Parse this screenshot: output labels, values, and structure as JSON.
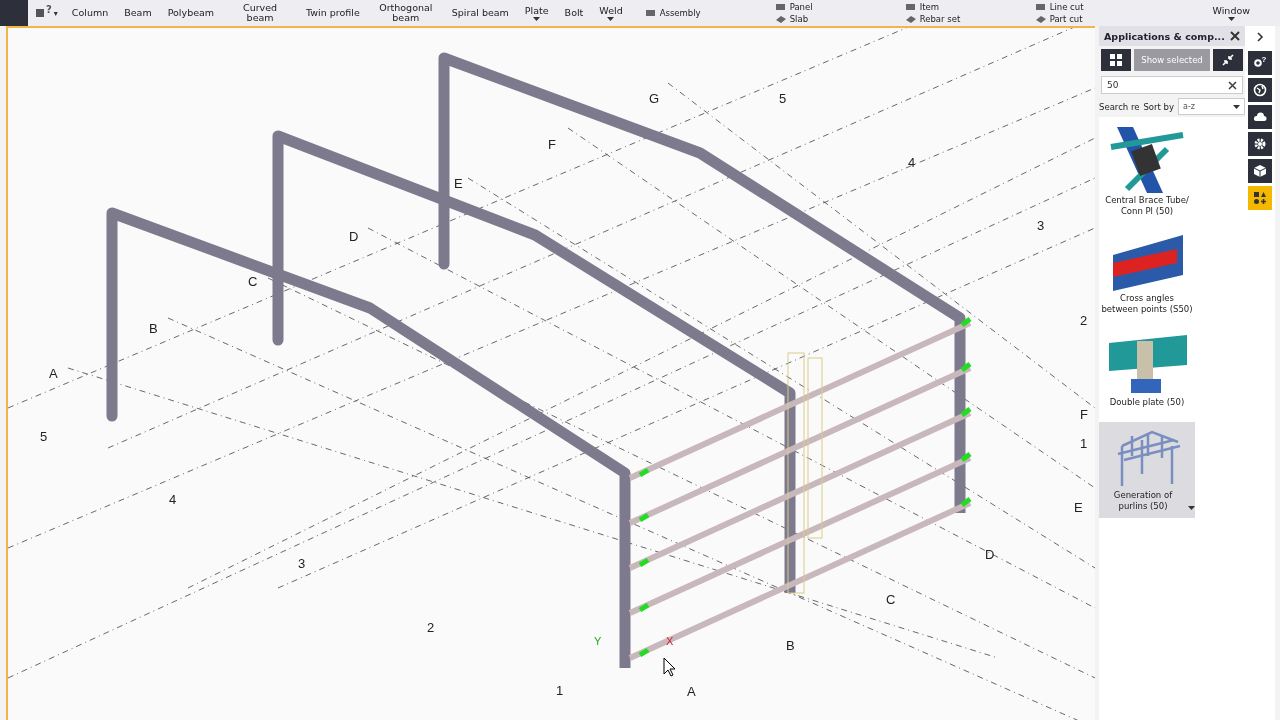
{
  "toolbar": {
    "help_mark": "?",
    "help_caret": "▾",
    "items": [
      {
        "label": "Column",
        "dropdown": false
      },
      {
        "label": "Beam",
        "dropdown": false
      },
      {
        "label": "Polybeam",
        "dropdown": false
      },
      {
        "label": "Curved beam",
        "dropdown": false
      },
      {
        "label": "Twin profile",
        "dropdown": false
      },
      {
        "label": "Orthogonal beam",
        "dropdown": false
      },
      {
        "label": "Spiral beam",
        "dropdown": false
      },
      {
        "label": "Plate",
        "dropdown": true
      },
      {
        "label": "Bolt",
        "dropdown": false
      },
      {
        "label": "Weld",
        "dropdown": true
      }
    ],
    "stacked": [
      {
        "top": "Assembly"
      },
      {
        "top": "Panel",
        "bottom": "Slab"
      },
      {
        "top": "Item",
        "bottom": "Rebar set"
      },
      {
        "top": "Line cut",
        "bottom": "Part cut"
      }
    ],
    "window": {
      "label": "Window",
      "dropdown": true
    }
  },
  "viewport": {
    "grid_labels": [
      "A",
      "B",
      "C",
      "D",
      "E",
      "F",
      "G",
      "5",
      "4",
      "3",
      "2",
      "F",
      "1",
      "E",
      "D",
      "C",
      "B",
      "1",
      "A",
      "2",
      "3",
      "4",
      "5"
    ],
    "axis_labels": [
      "Y",
      "X"
    ]
  },
  "panel": {
    "title": "Applications & comp...",
    "show_selected": {
      "label": "Show selected",
      "disabled": true
    },
    "search": {
      "value": "50"
    },
    "search_label": "Search re",
    "sort_label": "Sort by",
    "sort_value": "a-z",
    "items": [
      {
        "label": "Central Brace Tube/ Conn Pl (50)",
        "kind": "brace",
        "selected": false
      },
      {
        "label": "Cross angles between points (S50)",
        "kind": "angles",
        "selected": false
      },
      {
        "label": "Double plate (50)",
        "kind": "plate",
        "selected": false
      },
      {
        "label": "Generation of purlins (50)",
        "kind": "purlins",
        "selected": true
      }
    ]
  },
  "side_tabs": [
    {
      "kind": "help",
      "mark": "?",
      "selected": false
    },
    {
      "kind": "globe",
      "selected": false
    },
    {
      "kind": "cloud",
      "selected": false
    },
    {
      "kind": "gear",
      "selected": false
    },
    {
      "kind": "cube",
      "selected": false
    },
    {
      "kind": "shapes",
      "selected": true
    }
  ]
}
